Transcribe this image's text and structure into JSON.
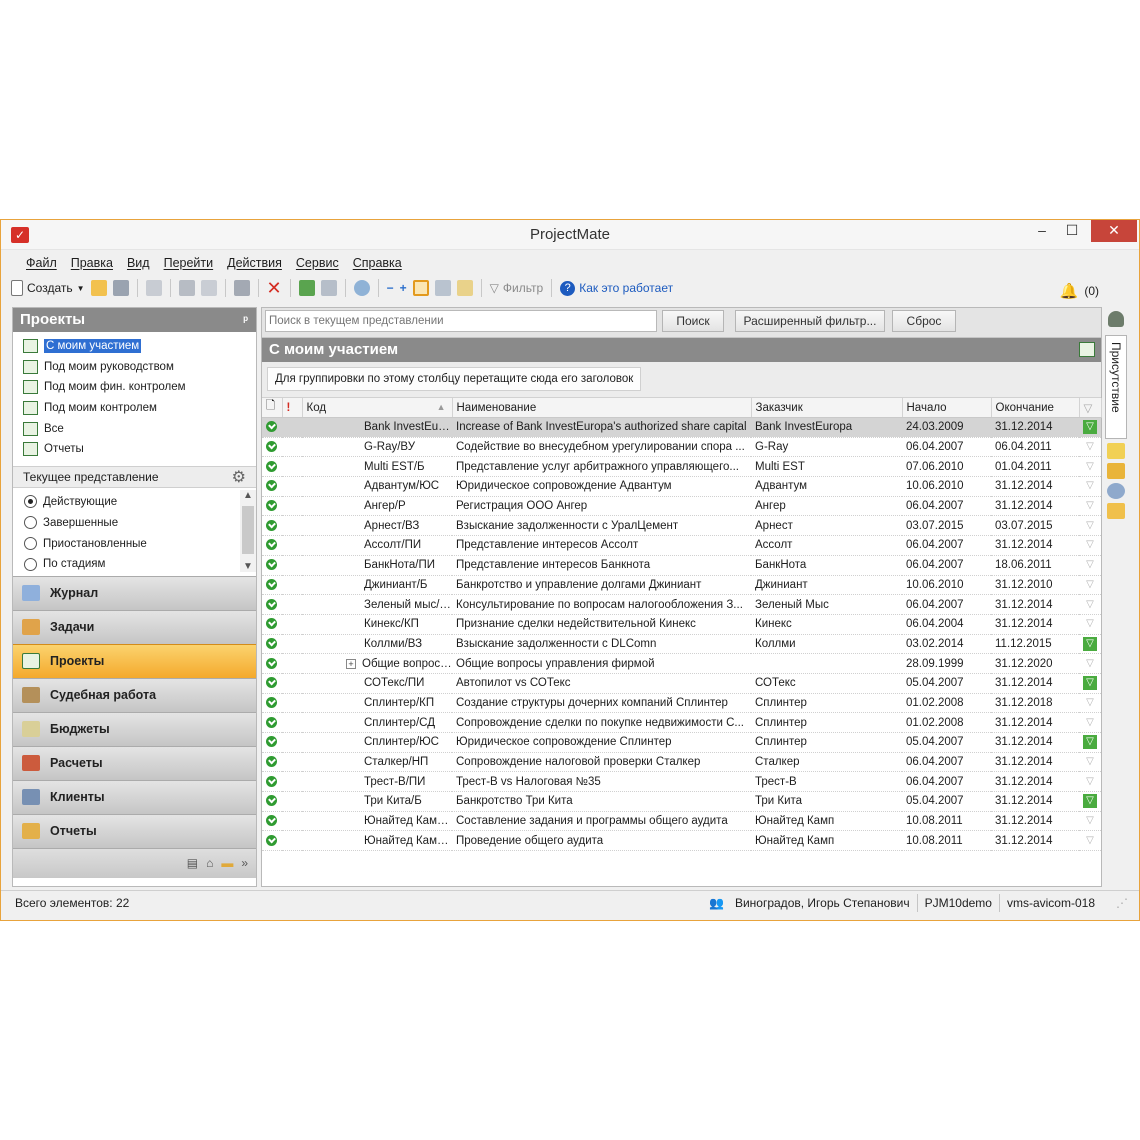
{
  "window": {
    "title": "ProjectMate"
  },
  "menu": [
    "Файл",
    "Правка",
    "Вид",
    "Перейти",
    "Действия",
    "Сервис",
    "Справка"
  ],
  "toolbar": {
    "create_label": "Создать",
    "filter_label": "Фильтр",
    "help_label": "Как это работает",
    "notify_count": "(0)"
  },
  "projects_panel": {
    "title": "Проекты",
    "items": [
      "С моим участием",
      "Под моим руководством",
      "Под моим фин. контролем",
      "Под моим контролем",
      "Все",
      "Отчеты"
    ],
    "view_title": "Текущее представление",
    "views": [
      "Действующие",
      "Завершенные",
      "Приостановленные",
      "По стадиям"
    ]
  },
  "nav": [
    "Журнал",
    "Задачи",
    "Проекты",
    "Судебная работа",
    "Бюджеты",
    "Расчеты",
    "Клиенты",
    "Отчеты"
  ],
  "search": {
    "placeholder": "Поиск в текущем представлении",
    "search_btn": "Поиск",
    "adv_btn": "Расширенный фильтр...",
    "reset_btn": "Сброс"
  },
  "grid": {
    "title": "С моим участием",
    "group_hint": "Для группировки по этому столбцу перетащите сюда его заголовок",
    "columns": [
      "Код",
      "Наименование",
      "Заказчик",
      "Начало",
      "Окончание"
    ],
    "rows": [
      [
        "Bank InvestEuropa/CL",
        "Increase of Bank InvestEuropa's authorized share capital",
        "Bank InvestEuropa",
        "24.03.2009",
        "31.12.2014"
      ],
      [
        "G-Ray/ВУ",
        "Содействие во внесудебном урегулировании спора ...",
        "G-Ray",
        "06.04.2007",
        "06.04.2011"
      ],
      [
        "Multi EST/Б",
        "Представление услуг арбитражного управляющего...",
        "Multi EST",
        "07.06.2010",
        "01.04.2011"
      ],
      [
        "Адвантум/ЮС",
        "Юридическое сопровождение Адвантум",
        "Адвантум",
        "10.06.2010",
        "31.12.2014"
      ],
      [
        "Ангер/Р",
        "Регистрация ООО Ангер",
        "Ангер",
        "06.04.2007",
        "31.12.2014"
      ],
      [
        "Арнест/ВЗ",
        "Взыскание задолженности с УралЦемент",
        "Арнест",
        "03.07.2015",
        "03.07.2015"
      ],
      [
        "Ассолт/ПИ",
        "Представление интересов Ассолт",
        "Ассолт",
        "06.04.2007",
        "31.12.2014"
      ],
      [
        "БанкНота/ПИ",
        "Представление интересов Банкнота",
        "БанкНота",
        "06.04.2007",
        "18.06.2011"
      ],
      [
        "Джиниант/Б",
        "Банкротство и управление долгами Джиниант",
        "Джиниант",
        "10.06.2010",
        "31.12.2010"
      ],
      [
        "Зеленый мыс/НП",
        "Консультирование по вопросам налогообложения З...",
        "Зеленый Мыс",
        "06.04.2007",
        "31.12.2014"
      ],
      [
        "Кинекс/КП",
        "Признание сделки недействительной Кинекс",
        "Кинекс",
        "06.04.2004",
        "31.12.2014"
      ],
      [
        "Коллми/ВЗ",
        "Взыскание задолженности с DLComn",
        "Коллми",
        "03.02.2014",
        "11.12.2015"
      ],
      [
        "Общие вопросы упр...",
        "Общие вопросы управления фирмой",
        "",
        "28.09.1999",
        "31.12.2020"
      ],
      [
        "СОТекс/ПИ",
        "Автопилот vs СОТекс",
        "СОТекс",
        "05.04.2007",
        "31.12.2014"
      ],
      [
        "Сплинтер/КП",
        "Создание структуры дочерних компаний Сплинтер",
        "Сплинтер",
        "01.02.2008",
        "31.12.2018"
      ],
      [
        "Сплинтер/СД",
        "Сопровождение сделки по покупке недвижимости С...",
        "Сплинтер",
        "01.02.2008",
        "31.12.2014"
      ],
      [
        "Сплинтер/ЮС",
        "Юридическое сопровождение Сплинтер",
        "Сплинтер",
        "05.04.2007",
        "31.12.2014"
      ],
      [
        "Сталкер/НП",
        "Сопровождение налоговой проверки Сталкер",
        "Сталкер",
        "06.04.2007",
        "31.12.2014"
      ],
      [
        "Трест-В/ПИ",
        "Трест-В vs Налоговая №35",
        "Трест-В",
        "06.04.2007",
        "31.12.2014"
      ],
      [
        "Три Кита/Б",
        "Банкротство Три Кита",
        "Три Кита",
        "05.04.2007",
        "31.12.2014"
      ],
      [
        "Юнайтед Камп/ЗА",
        "Составление задания и программы общего аудита",
        "Юнайтед Камп",
        "10.08.2011",
        "31.12.2014"
      ],
      [
        "Юнайтед Камп/ОА",
        "Проведение общего аудита",
        "Юнайтед Камп",
        "10.08.2011",
        "31.12.2014"
      ]
    ],
    "flagged_rows": [
      0,
      11,
      13,
      16,
      19
    ]
  },
  "right_tab": "Присутствие",
  "status": {
    "count": "Всего элементов: 22",
    "user": "Виноградов, Игорь Степанович",
    "db": "PJM10demo",
    "server": "vms-avicom-018"
  },
  "colors": {
    "accent_orange": "#f4a92c",
    "panel_grey": "#8a8a8a",
    "selection_blue": "#2f6fd2",
    "status_green": "#2f9b31"
  }
}
